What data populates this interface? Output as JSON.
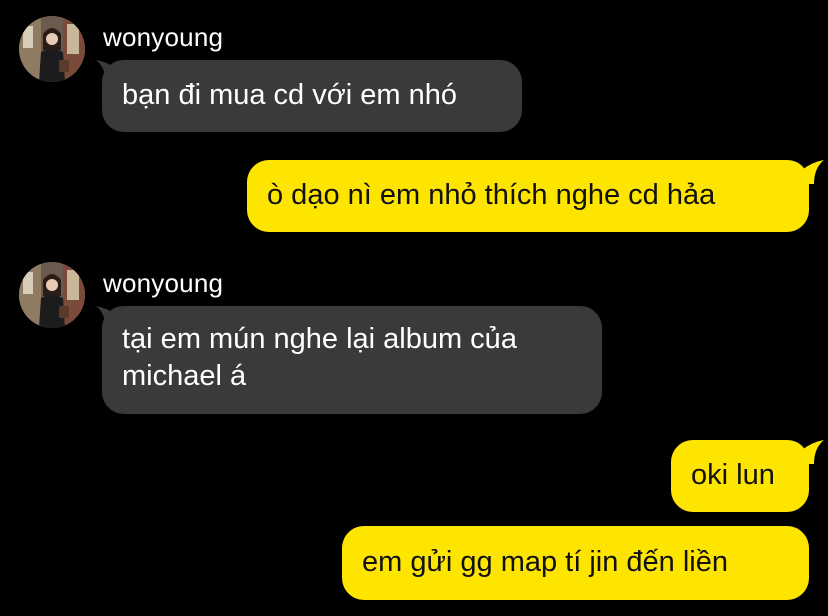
{
  "theme": {
    "background": "#000000",
    "incoming_bubble": "#3a3a3c",
    "outgoing_bubble": "#fee500",
    "incoming_text": "#ffffff",
    "outgoing_text": "#111111"
  },
  "messages": [
    {
      "direction": "incoming",
      "sender": "wonyoung",
      "avatar_icon": "profile-photo-avatar",
      "text": "bạn đi mua cd với em nhó"
    },
    {
      "direction": "outgoing",
      "text": "ò dạo nì em nhỏ thích nghe cd hảa"
    },
    {
      "direction": "incoming",
      "sender": "wonyoung",
      "avatar_icon": "profile-photo-avatar",
      "text": "tại em mún nghe lại album của\nmichael á"
    },
    {
      "direction": "outgoing",
      "text": "oki lun"
    },
    {
      "direction": "outgoing",
      "text": "em gửi gg map tí jin đến liền"
    }
  ]
}
